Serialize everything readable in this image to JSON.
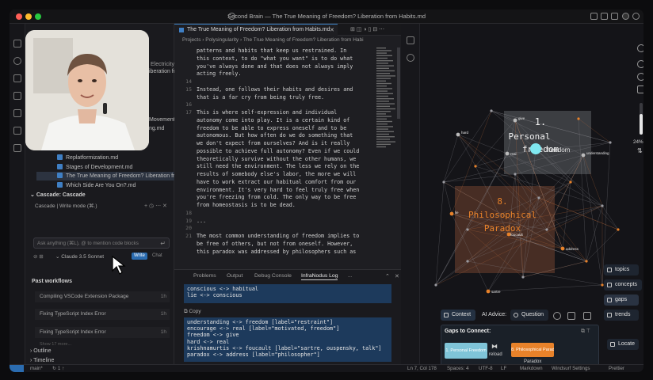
{
  "window": {
    "title": "Second Brain — The True Meaning of Freedom? Liberation from Habits.md"
  },
  "colors": {
    "accent": "#2b6cb0",
    "node_orange": "#e8822a",
    "node_cyan": "#7fe8f0",
    "cluster_gray": "#5c6066",
    "cluster_orange": "#7a4630",
    "selection_blue": "#1d3a5c"
  },
  "sidebar": {
    "partial_files": [
      "Electricity",
      "iberation fr...",
      "Movement.md",
      "ng.md"
    ],
    "files": [
      "Replatformization.md",
      "Stages of Development.md",
      "The True Meaning of Freedom? Liberation fr...",
      "Which Side Are You On?.md"
    ],
    "cascade": {
      "section_title": "Cascade: Cascade",
      "header_label": "Cascade | Write mode (⌘.)",
      "input_placeholder": "Ask anything (⌘L), @ to mention code blocks",
      "model_label": "Claude 3.5 Sonnet",
      "write_label": "Write",
      "chat_label": "Chat",
      "past_workflows_title": "Past workflows",
      "workflows": [
        {
          "label": "Compiling VSCode Extension Package",
          "age": "1h"
        },
        {
          "label": "Fixing TypeScript Index Error",
          "age": "1h"
        },
        {
          "label": "Fixing TypeScript Index Error",
          "age": "1h"
        }
      ],
      "show_more": "Show 17 more..."
    },
    "outline_label": "Outline",
    "timeline_label": "Timeline"
  },
  "editor": {
    "tab_title": "The True Meaning of Freedom? Liberation from Habits.md",
    "breadcrumb": [
      "Projects",
      "Polysingularity",
      "The True Meaning of Freedom? Liberation from Habi"
    ],
    "lines": [
      {
        "n": "",
        "t": "patterns and habits that keep us restrained. In"
      },
      {
        "n": "",
        "t": "this context, to do \"what you want\" is to do what"
      },
      {
        "n": "",
        "t": "you've always done and that does not always imply"
      },
      {
        "n": "",
        "t": "acting freely."
      },
      {
        "n": "14",
        "t": ""
      },
      {
        "n": "15",
        "t": "Instead, one follows their habits and desires and"
      },
      {
        "n": "",
        "t": "that is a far cry from being truly free."
      },
      {
        "n": "16",
        "t": ""
      },
      {
        "n": "17",
        "t": "This is where self-expression and individual"
      },
      {
        "n": "",
        "t": "autonomy come into play. It is a certain kind of"
      },
      {
        "n": "",
        "t": "freedom to be able to express oneself and to be"
      },
      {
        "n": "",
        "t": "autonomous. But how often do we do something that"
      },
      {
        "n": "",
        "t": "we don't expect from ourselves? And is it really"
      },
      {
        "n": "",
        "t": "possible to achieve full autonomy? Even if we could"
      },
      {
        "n": "",
        "t": "theoretically survive without the other humans, we"
      },
      {
        "n": "",
        "t": "still need the environment. The less we rely on the"
      },
      {
        "n": "",
        "t": "results of somebody else's labor, the more we will"
      },
      {
        "n": "",
        "t": "have to work extract our habitual comfort from our"
      },
      {
        "n": "",
        "t": "environment. It's very hard to feel truly free when"
      },
      {
        "n": "",
        "t": "you're freezing from cold. The only way to be free"
      },
      {
        "n": "",
        "t": "from homeostasis is to be dead."
      },
      {
        "n": "18",
        "t": ""
      },
      {
        "n": "19",
        "t": "..."
      },
      {
        "n": "20",
        "t": ""
      },
      {
        "n": "21",
        "t": "The most common understanding of freedom implies to"
      },
      {
        "n": "",
        "t": "be free of others, but not from oneself. However,"
      },
      {
        "n": "",
        "t": "this paradox was addressed by philosophers such as"
      }
    ]
  },
  "panel": {
    "tabs": [
      "Problems",
      "Output",
      "Debug Console",
      "InfraNodus Log",
      "..."
    ],
    "log_top": [
      "conscious <-> habitual",
      "lie <-> conscious"
    ],
    "copy_label": "Copy",
    "log_bottom": [
      "understanding <-> freedom [label=\"restraint\"]",
      "encourage <-> real [label=\"motivated, freedom\"]",
      "freedom <-> give",
      "hard <-> real",
      "krishnamurtis <-> foucault [label=\"sartre, ouspensky, talk\"]",
      "paradox <-> address [label=\"philosopher\"]"
    ]
  },
  "graph": {
    "cluster1": {
      "label_num": "1.",
      "label_l1": "Personal",
      "label_l2": "freedom"
    },
    "cluster8": {
      "label_num": "8.",
      "label_l1": "Philosophical",
      "label_l2": "Paradox"
    },
    "node_labels": [
      "give",
      "hard",
      "real",
      "understanding",
      "address",
      "sartre",
      "foucault",
      "lie",
      "freedom"
    ],
    "zoom_label": "24%",
    "filters": [
      "topics",
      "concepts",
      "gaps",
      "trends"
    ],
    "context_label": "Context",
    "ai_advice_label": "AI Advice:",
    "question_label": "Question",
    "gaps_title": "Gaps to Connect:",
    "gap_left": "1. Personal Freedom",
    "gap_right": "8. Philosophical Paradox",
    "reload_label": "reload",
    "paradox_label": "Paradox",
    "locate_label": "Locate"
  },
  "status": {
    "branch": "main*",
    "sync": "↻ 1 ↑",
    "position": "Ln 7, Col 178",
    "spaces": "Spaces: 4",
    "encoding": "UTF-8",
    "eol": "LF",
    "language": "Markdown",
    "windsurf": "Windsurf Settings",
    "prettier": "Prettier"
  }
}
